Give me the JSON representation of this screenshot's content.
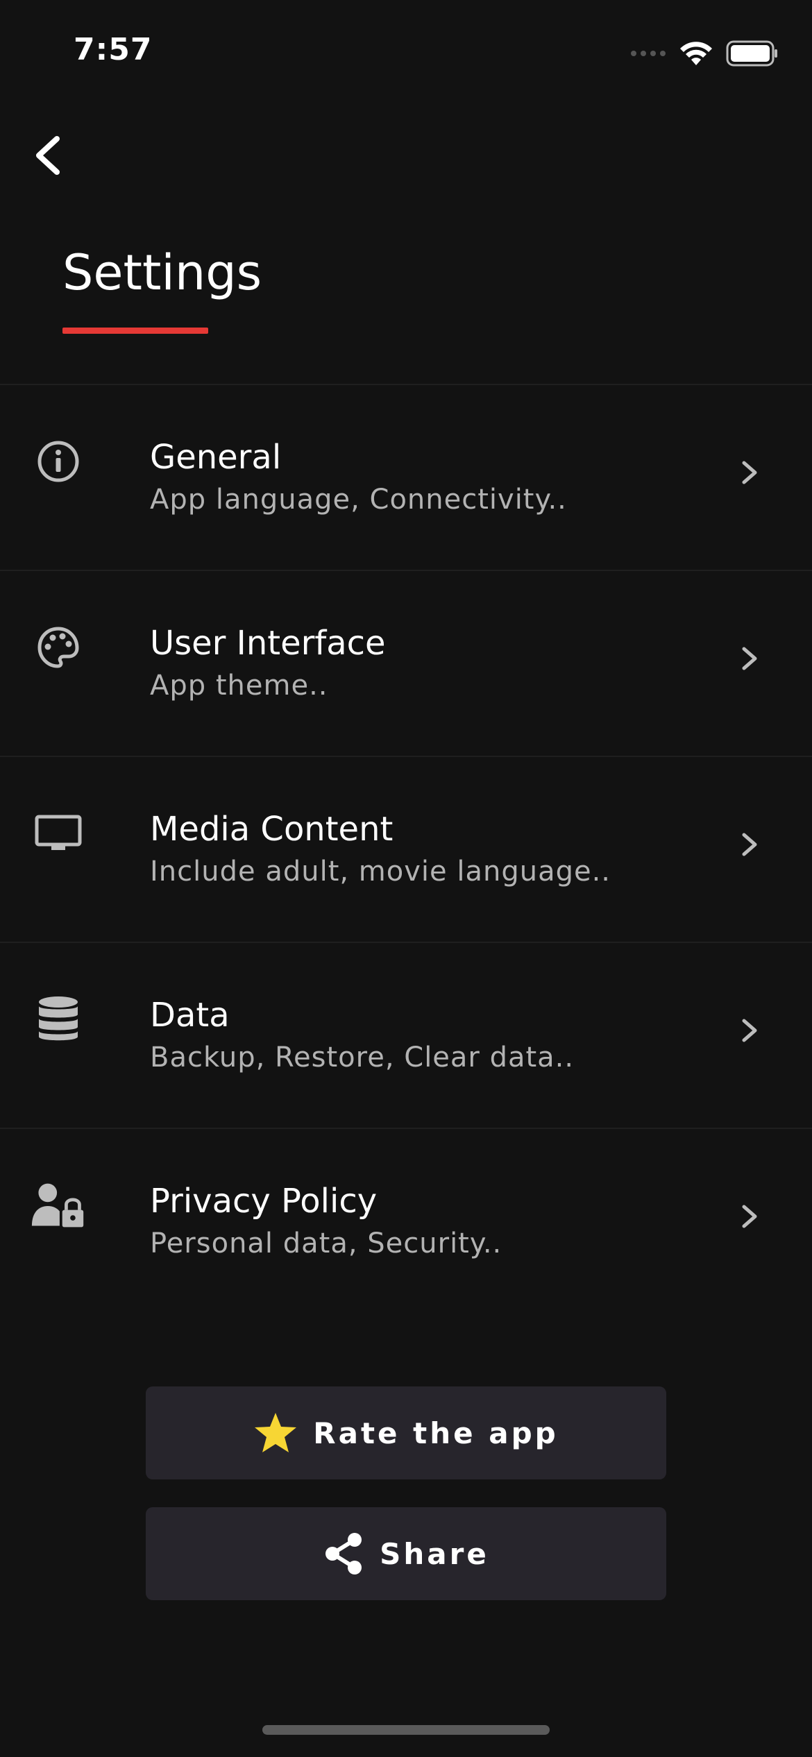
{
  "status_bar": {
    "time": "7:57"
  },
  "header": {
    "title": "Settings",
    "accent_color": "#e53935"
  },
  "settings": [
    {
      "title": "General",
      "subtitle": "App language, Connectivity..",
      "icon": "info-icon"
    },
    {
      "title": "User Interface",
      "subtitle": "App theme..",
      "icon": "palette-icon"
    },
    {
      "title": "Media Content",
      "subtitle": "Include adult, movie language..",
      "icon": "monitor-icon"
    },
    {
      "title": "Data",
      "subtitle": "Backup, Restore, Clear data..",
      "icon": "database-icon"
    },
    {
      "title": "Privacy Policy",
      "subtitle": "Personal data, Security..",
      "icon": "user-lock-icon"
    }
  ],
  "actions": {
    "rate_label": "Rate the app",
    "share_label": "Share",
    "rate_icon": "star-icon",
    "share_icon": "share-icon",
    "star_color": "#f7d634"
  }
}
